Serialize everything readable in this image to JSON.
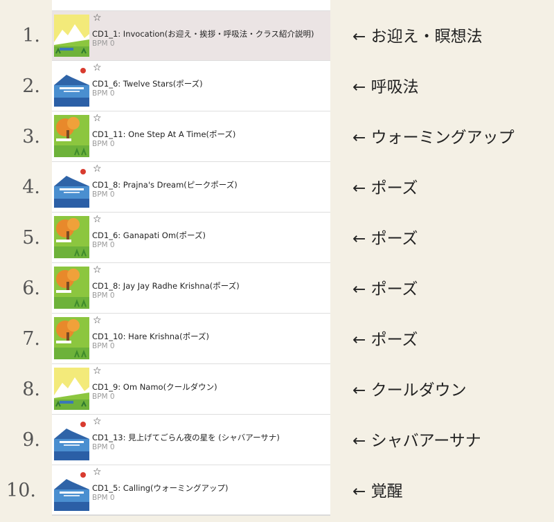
{
  "playlist": {
    "tracks": [
      {
        "number": "1.",
        "star": "☆",
        "title": "CD1_1: Invocation(お迎え・挨拶・呼吸法・クラス紹介説明)",
        "bpm": "BPM 0",
        "label": "← お迎え・瞑想法",
        "art": "yellow-mountain-art",
        "selected": true
      },
      {
        "number": "2.",
        "star": "☆",
        "title": "CD1_6: Twelve Stars(ポーズ)",
        "bpm": "BPM 0",
        "label": "← 呼吸法",
        "art": "blue-mountain-art"
      },
      {
        "number": "3.",
        "star": "☆",
        "title": "CD1_11: One Step At A Time(ポーズ)",
        "bpm": "BPM 0",
        "label": "← ウォーミングアップ",
        "art": "green-tree-art"
      },
      {
        "number": "4.",
        "star": "☆",
        "title": "CD1_8: Prajna's Dream(ピークポーズ)",
        "bpm": "BPM 0",
        "label": "← ポーズ",
        "art": "blue-mountain-art"
      },
      {
        "number": "5.",
        "star": "☆",
        "title": "CD1_6: Ganapati Om(ポーズ)",
        "bpm": "BPM 0",
        "label": "← ポーズ",
        "art": "green-tree-art"
      },
      {
        "number": "6.",
        "star": "☆",
        "title": "CD1_8: Jay Jay Radhe Krishna(ポーズ)",
        "bpm": "BPM 0",
        "label": "← ポーズ",
        "art": "green-tree-art"
      },
      {
        "number": "7.",
        "star": "☆",
        "title": "CD1_10: Hare Krishna(ポーズ)",
        "bpm": "BPM 0",
        "label": "← ポーズ",
        "art": "green-tree-art"
      },
      {
        "number": "8.",
        "star": "☆",
        "title": "CD1_9: Om Namo(クールダウン)",
        "bpm": "BPM 0",
        "label": "← クールダウン",
        "art": "yellow-mountain-art"
      },
      {
        "number": "9.",
        "star": "☆",
        "title": "CD1_13: 見上げてごらん夜の星を (シャバアーサナ)",
        "bpm": "BPM 0",
        "label": "← シャバアーサナ",
        "art": "blue-mountain-art"
      },
      {
        "number": "10.",
        "star": "☆",
        "title": "CD1_5: Calling(ウォーミングアップ)",
        "bpm": "BPM 0",
        "label": "← 覚醒",
        "art": "blue-mountain-art"
      }
    ]
  },
  "colors": {
    "background": "#f4f0e5",
    "selected_row": "#ebe4e4",
    "art_yellow_sky": "#f3ea7a",
    "art_blue_sky": "#ffffff",
    "art_blue_mountain": "#2f64a8",
    "art_green": "#8cc63f",
    "art_orange": "#e8892b",
    "art_red_sun": "#d83b2f"
  }
}
